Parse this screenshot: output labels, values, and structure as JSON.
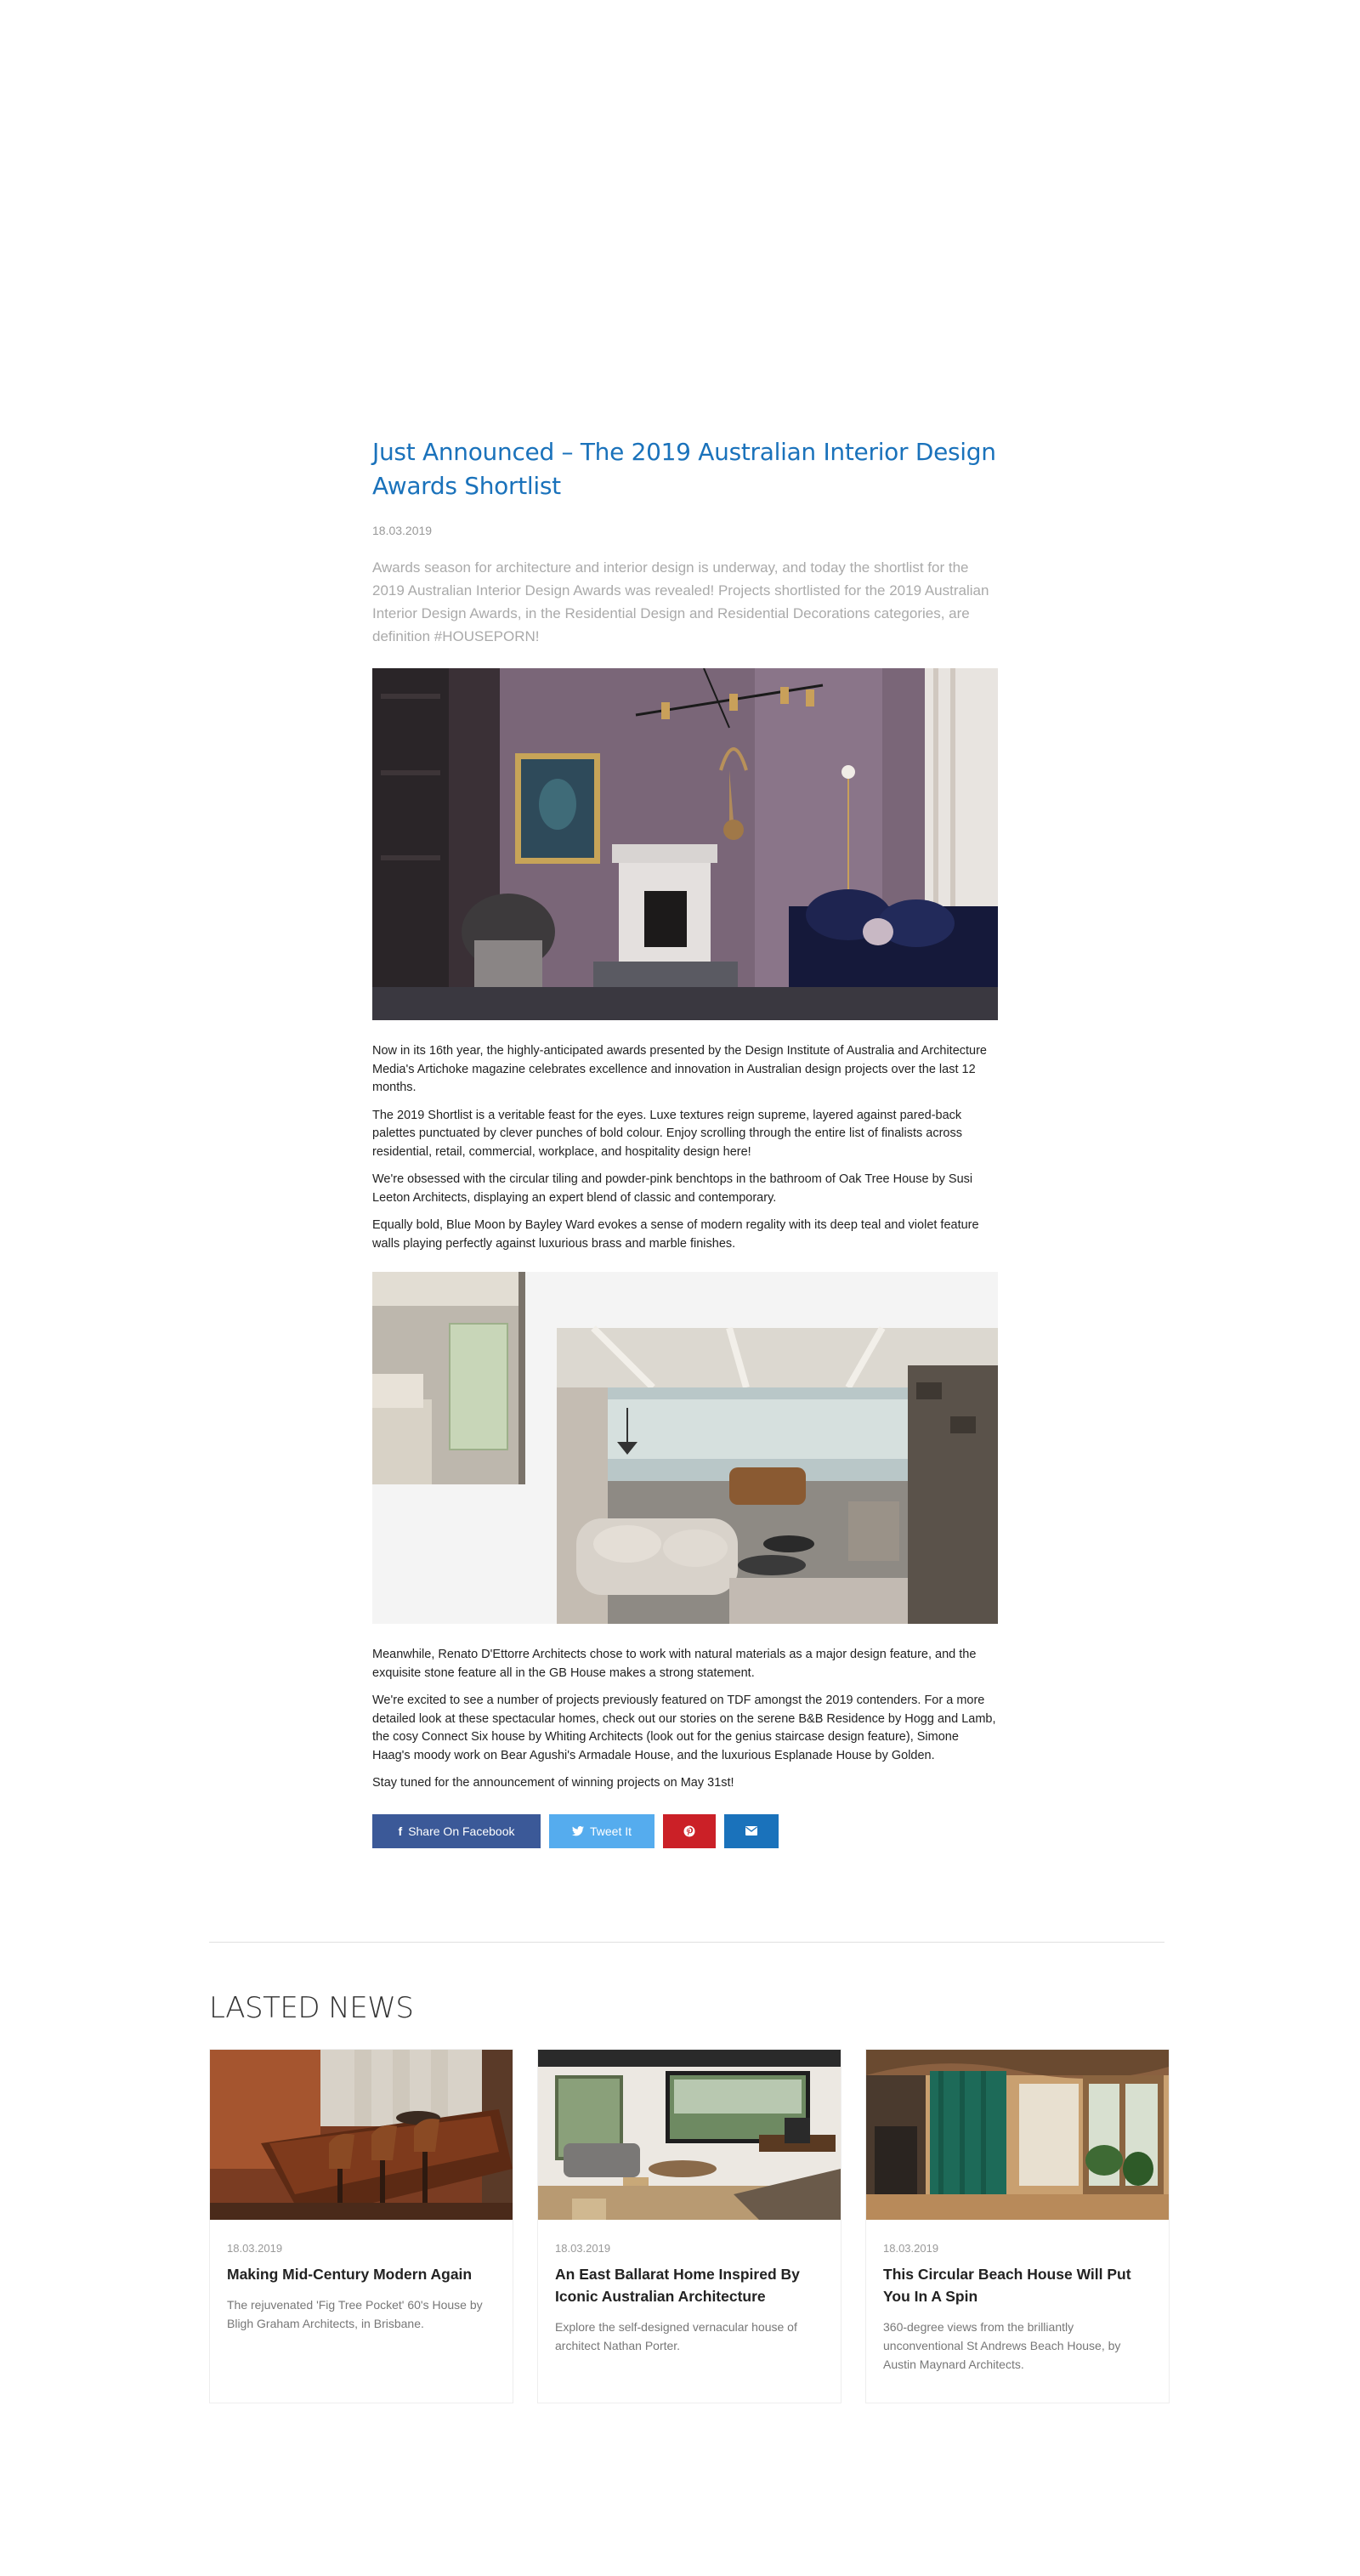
{
  "article": {
    "title": "Just Announced – The 2019 Australian Interior Design Awards Shortlist",
    "date": "18.03.2019",
    "lead": "Awards season for architecture and interior design is underway, and today the shortlist for the 2019 Australian Interior Design Awards was revealed! Projects shortlisted for the 2019 Australian Interior Design Awards, in the Residential Design and Residential Decorations categories, are definition #HOUSEPORN!",
    "paragraphs_1": [
      "Now in its 16th year, the highly-anticipated awards presented by the Design Institute of Australia and Architecture Media's Artichoke magazine celebrates excellence and innovation in Australian design projects over the last 12 months.",
      "The 2019 Shortlist is a veritable feast for the eyes. Luxe textures reign supreme, layered against pared-back palettes punctuated by clever punches of bold colour. Enjoy scrolling through the entire list of finalists across residential, retail, commercial, workplace, and hospitality design here!",
      "We're obsessed with the circular tiling and powder-pink benchtops in the bathroom of Oak Tree House by Susi Leeton Architects, displaying an expert blend of classic and contemporary.",
      "Equally bold, Blue Moon by Bayley Ward evokes a sense of modern regality with its deep teal and violet feature walls playing perfectly against luxurious brass and marble finishes."
    ],
    "paragraphs_2": [
      "Meanwhile, Renato D'Ettorre Architects chose to work with natural materials as a major design feature, and the exquisite stone feature all in the GB House makes a strong statement.",
      "We're excited to see a number of projects previously featured on TDF amongst the 2019 contenders. For a more detailed look at these spectacular homes, check out our stories on the serene B&B Residence by Hogg and Lamb, the cosy Connect Six house by Whiting Architects (look out for the genius staircase design feature), Simone Haag's moody work on Bear Agushi's Armadale House, and the luxurious Esplanade House by Golden.",
      "Stay tuned for the announcement of winning projects on May 31st!"
    ]
  },
  "share": {
    "facebook_label": "Share On Facebook",
    "twitter_label": "Tweet It",
    "pinterest_icon": "pinterest-icon",
    "email_icon": "envelope-icon"
  },
  "latest_news": {
    "heading": "LASTED NEWS",
    "cards": [
      {
        "date": "18.03.2019",
        "title": "Making Mid-Century Modern Again",
        "desc": "The rejuvenated 'Fig Tree Pocket' 60's House by Bligh Graham Architects, in Brisbane."
      },
      {
        "date": "18.03.2019",
        "title": "An East Ballarat Home Inspired By Iconic Australian Architecture",
        "desc": "Explore the self-designed vernacular house of architect Nathan Porter."
      },
      {
        "date": "18.03.2019",
        "title": "This Circular Beach House Will Put You In A Spin",
        "desc": "360-degree views from the brilliantly unconventional St Andrews Beach House, by Austin Maynard Architects."
      }
    ]
  },
  "colors": {
    "title_blue": "#1a72bb",
    "facebook": "#3b5998",
    "twitter": "#55acee",
    "pinterest": "#cb2027",
    "email": "#1a72bb"
  }
}
